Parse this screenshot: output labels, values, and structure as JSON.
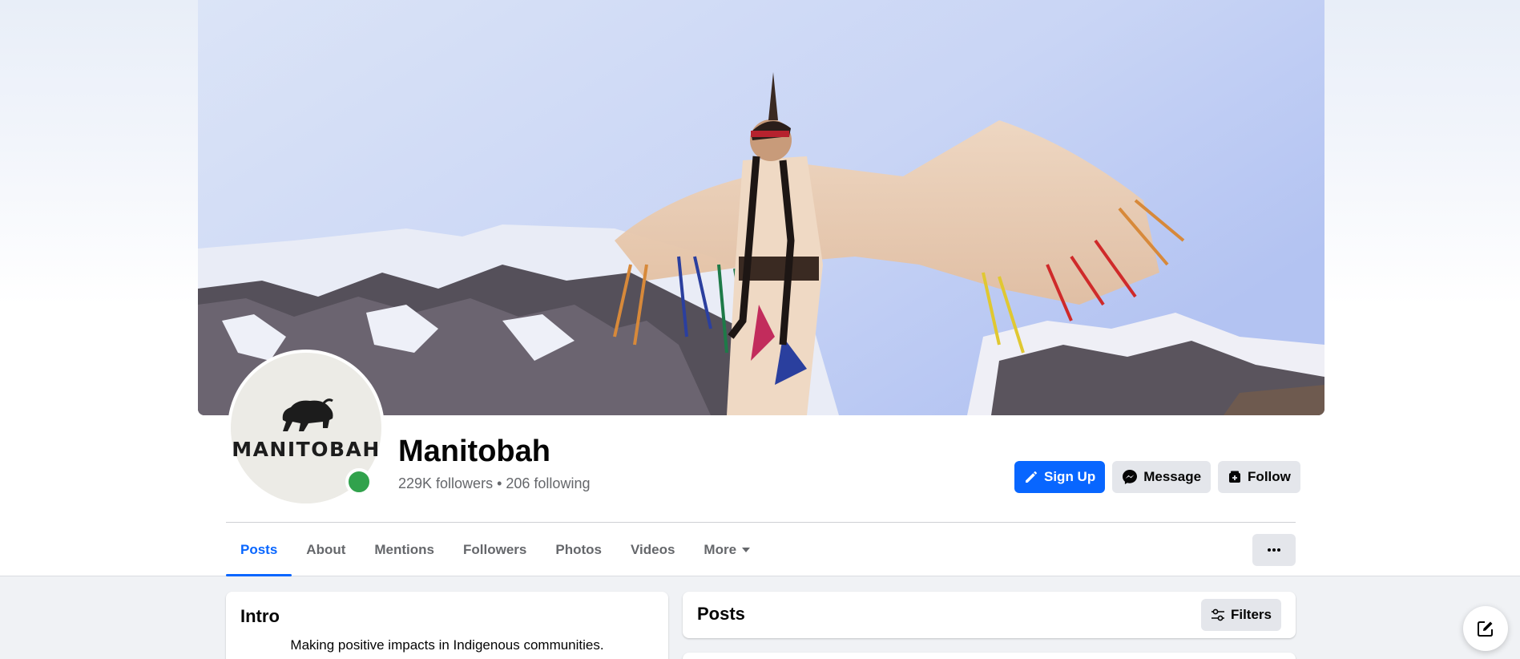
{
  "page": {
    "name": "Manitobah",
    "followers": "229K followers",
    "separator": "•",
    "following": "206 following",
    "avatar_logo_text": "MANITOBAH"
  },
  "actions": {
    "sign_up": "Sign Up",
    "message": "Message",
    "follow": "Follow"
  },
  "tabs": [
    {
      "label": "Posts",
      "active": true
    },
    {
      "label": "About"
    },
    {
      "label": "Mentions"
    },
    {
      "label": "Followers"
    },
    {
      "label": "Photos"
    },
    {
      "label": "Videos"
    },
    {
      "label": "More"
    }
  ],
  "intro": {
    "title": "Intro",
    "bio": "Making positive impacts in Indigenous communities."
  },
  "posts": {
    "title": "Posts",
    "filters_label": "Filters"
  },
  "colors": {
    "accent": "#0866ff",
    "online": "#31a24c",
    "secondary_button": "#e4e6eb"
  },
  "icons": {
    "sign_up": "pencil-icon",
    "message": "messenger-icon",
    "follow": "follow-icon",
    "more_tab": "caret-down-icon",
    "overflow": "more-dots-icon",
    "filters": "sliders-icon",
    "compose": "compose-icon"
  }
}
